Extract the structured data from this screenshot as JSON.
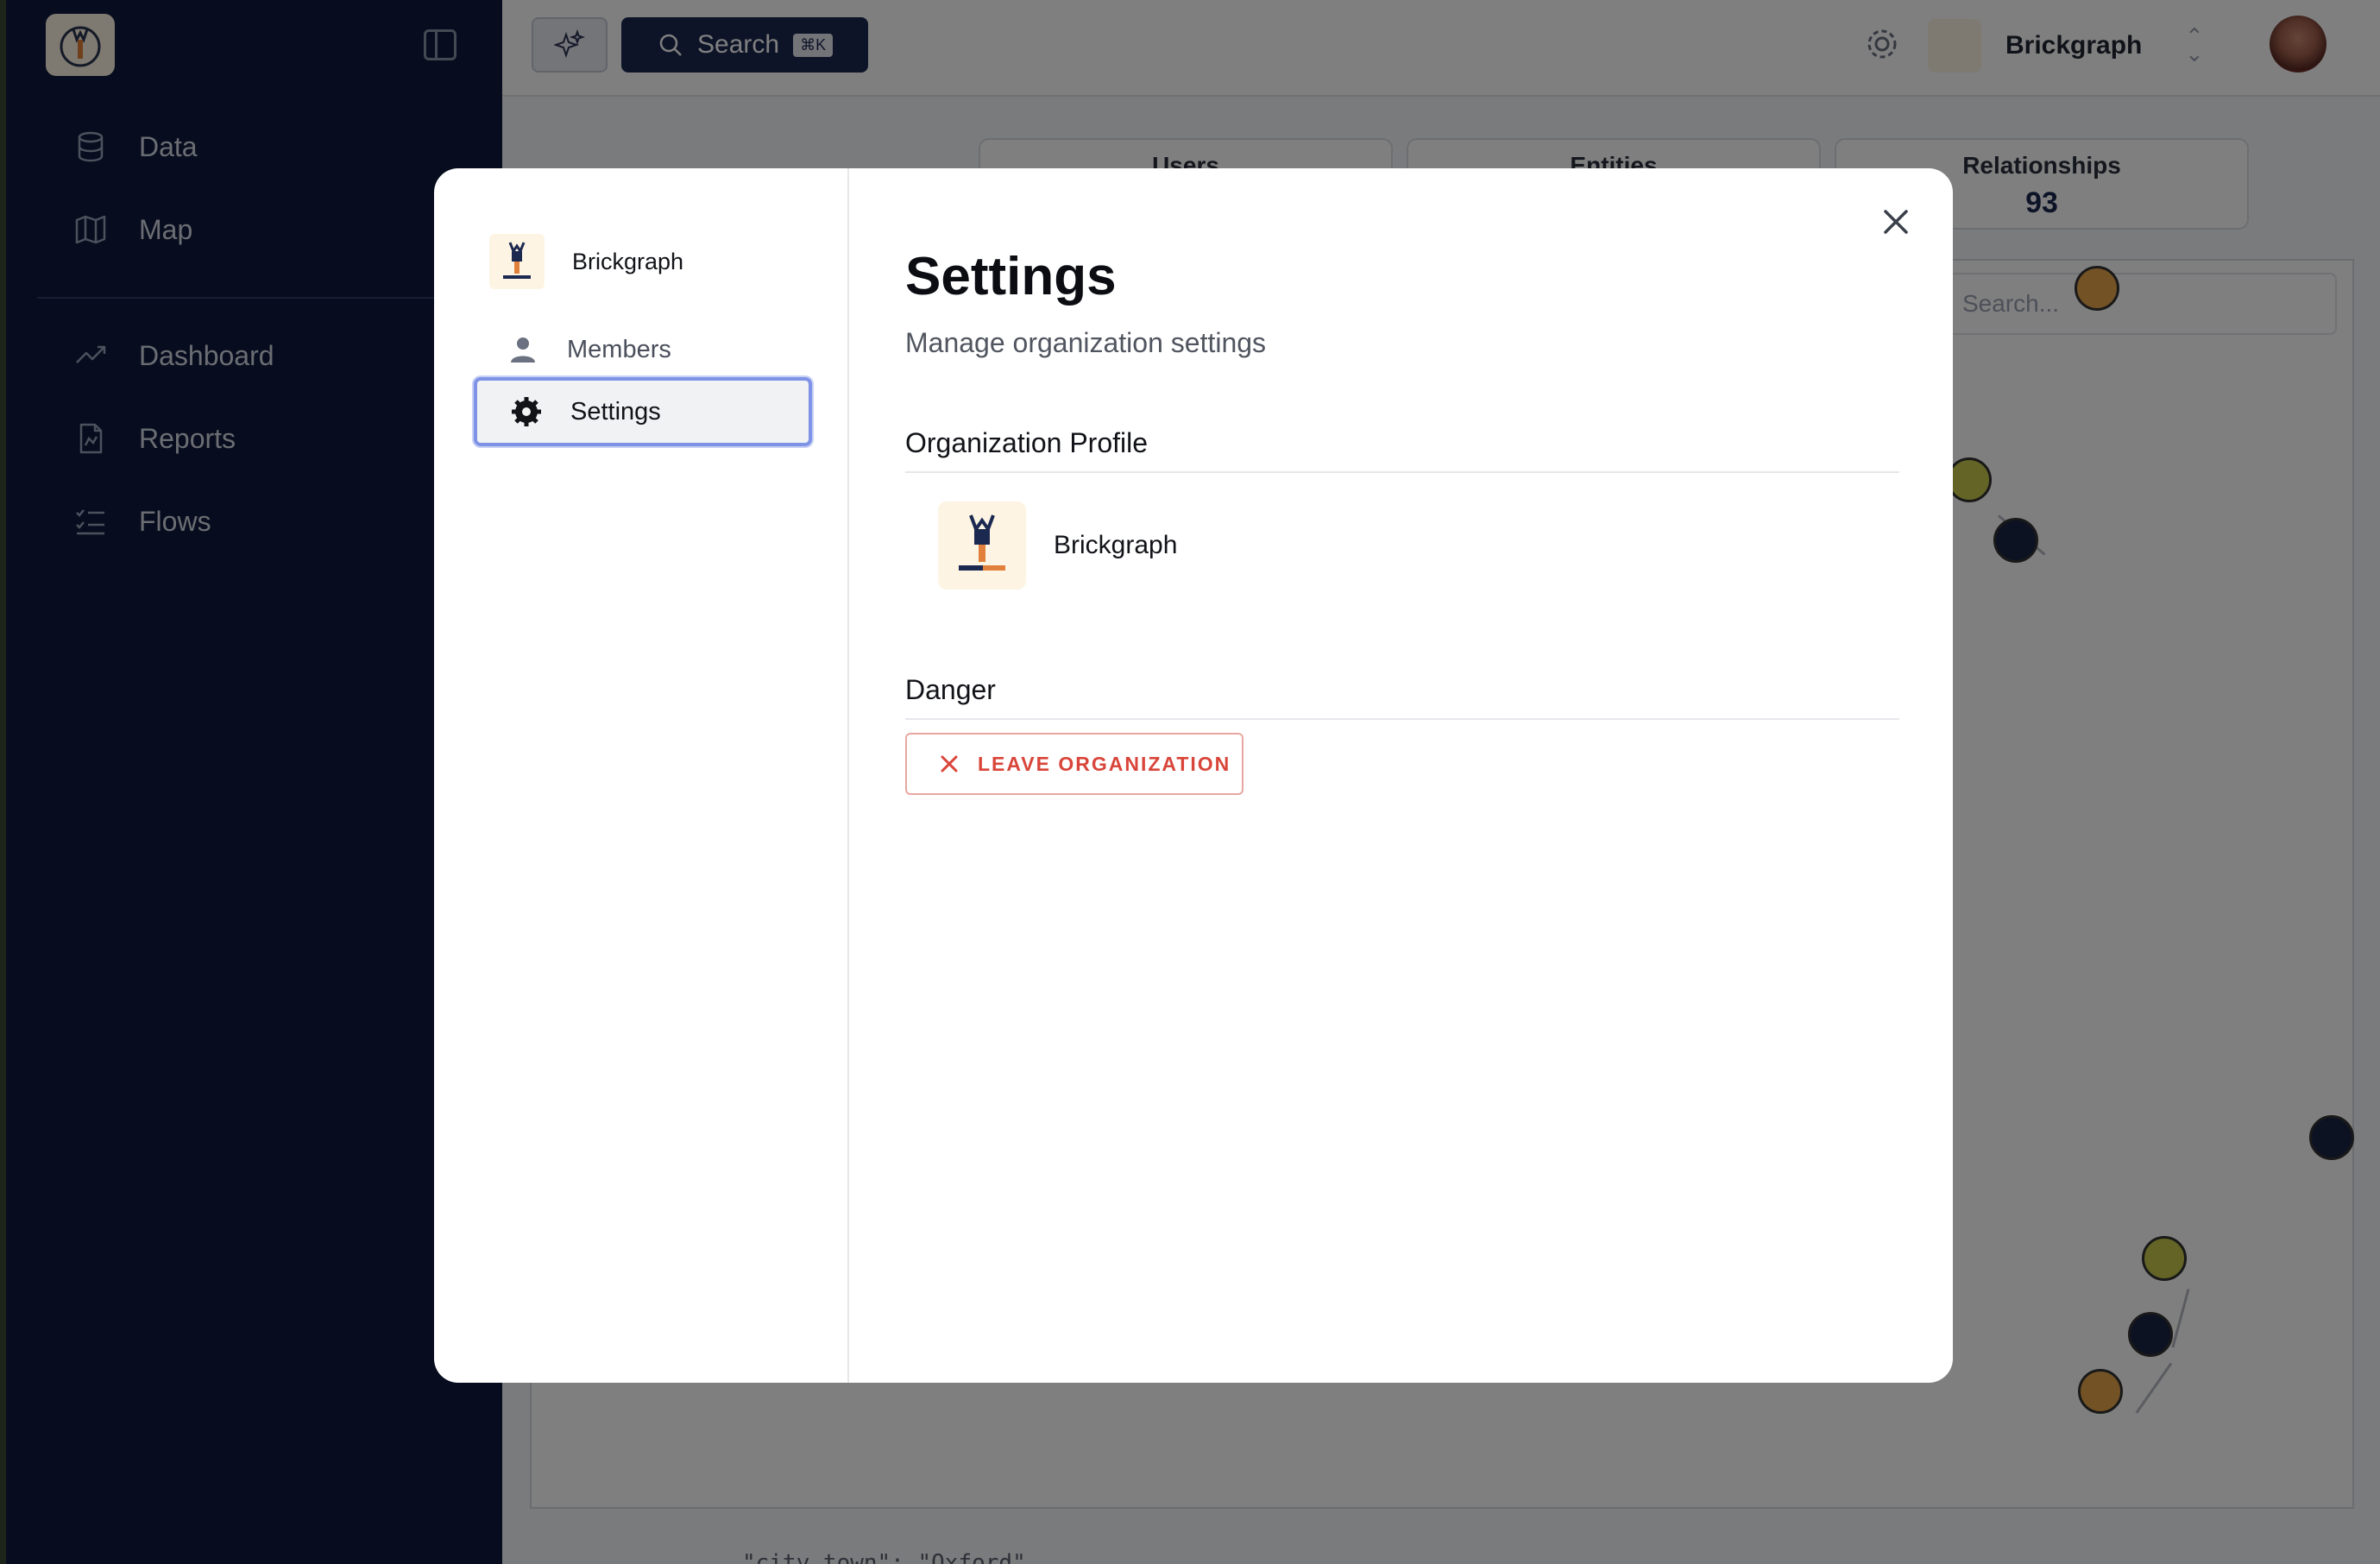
{
  "sidebar": {
    "items": [
      {
        "label": "Data",
        "icon": "database-icon"
      },
      {
        "label": "Map",
        "icon": "map-icon"
      },
      {
        "label": "Dashboard",
        "icon": "trending-up-icon"
      },
      {
        "label": "Reports",
        "icon": "report-icon"
      },
      {
        "label": "Flows",
        "icon": "list-check-icon"
      }
    ]
  },
  "topbar": {
    "search_label": "Search",
    "search_shortcut": "⌘K",
    "org_name": "Brickgraph"
  },
  "stats": [
    {
      "label": "Users",
      "value": ""
    },
    {
      "label": "Entities",
      "value": ""
    },
    {
      "label": "Relationships",
      "value": "93"
    }
  ],
  "graph": {
    "search_placeholder": "Search..."
  },
  "footer_code": "\"city_town\": \"Oxford\"",
  "modal": {
    "org_name": "Brickgraph",
    "nav": [
      {
        "label": "Members",
        "icon": "person-icon"
      },
      {
        "label": "Settings",
        "icon": "gear-icon"
      }
    ],
    "title": "Settings",
    "subtitle": "Manage organization settings",
    "profile_section": "Organization Profile",
    "profile_name": "Brickgraph",
    "danger_section": "Danger",
    "leave_button": "LEAVE ORGANIZATION"
  },
  "colors": {
    "sidebar_bg": "#0f1b3d",
    "accent_navy": "#1b2850",
    "danger_red": "#d9453a",
    "focus_ring": "#7f93e6"
  }
}
